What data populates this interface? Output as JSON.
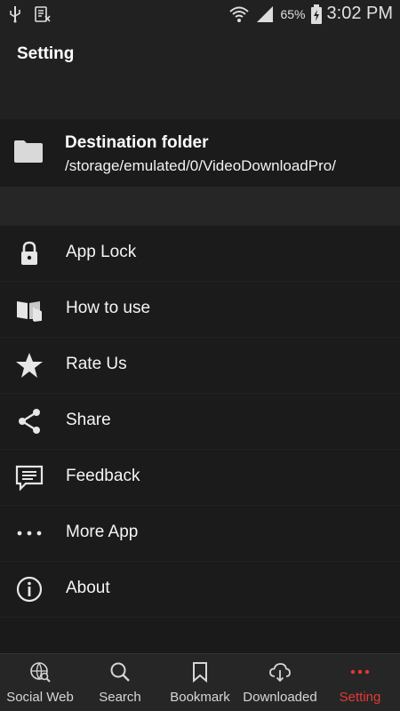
{
  "status_bar": {
    "battery": "65%",
    "time": "3:02 PM"
  },
  "app_bar": {
    "title": "Setting"
  },
  "destination": {
    "title": "Destination folder",
    "path": "/storage/emulated/0/VideoDownloadPro/"
  },
  "menu": {
    "items": [
      {
        "label": "App Lock",
        "icon": "lock-icon"
      },
      {
        "label": "How to use",
        "icon": "book-icon"
      },
      {
        "label": "Rate Us",
        "icon": "star-icon"
      },
      {
        "label": "Share",
        "icon": "share-icon"
      },
      {
        "label": "Feedback",
        "icon": "feedback-icon"
      },
      {
        "label": "More App",
        "icon": "more-icon"
      },
      {
        "label": "About",
        "icon": "info-icon"
      }
    ]
  },
  "bottom_nav": {
    "items": [
      {
        "label": "Social Web",
        "icon": "globe-search-icon"
      },
      {
        "label": "Search",
        "icon": "search-icon"
      },
      {
        "label": "Bookmark",
        "icon": "bookmark-icon"
      },
      {
        "label": "Downloaded",
        "icon": "cloud-download-icon"
      },
      {
        "label": "Setting",
        "icon": "more-icon"
      }
    ],
    "active_color": "#e53935"
  }
}
